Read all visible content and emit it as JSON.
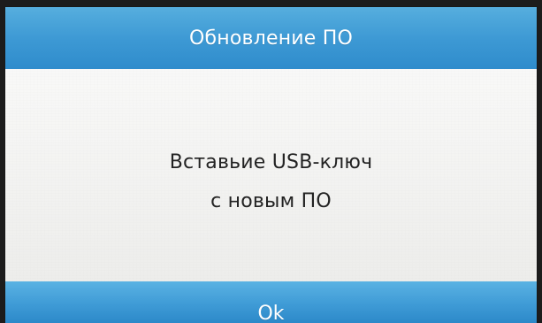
{
  "dialog": {
    "title": "Обновление ПО",
    "message_line_1": "Вставьие USB-ключ",
    "message_line_2": "с новым ПО",
    "ok_label": "Ok"
  },
  "colors": {
    "title_bar": "#3d99d4",
    "content_background": "#f1f1ef",
    "text": "#222222",
    "button": "#3f9bd6"
  }
}
